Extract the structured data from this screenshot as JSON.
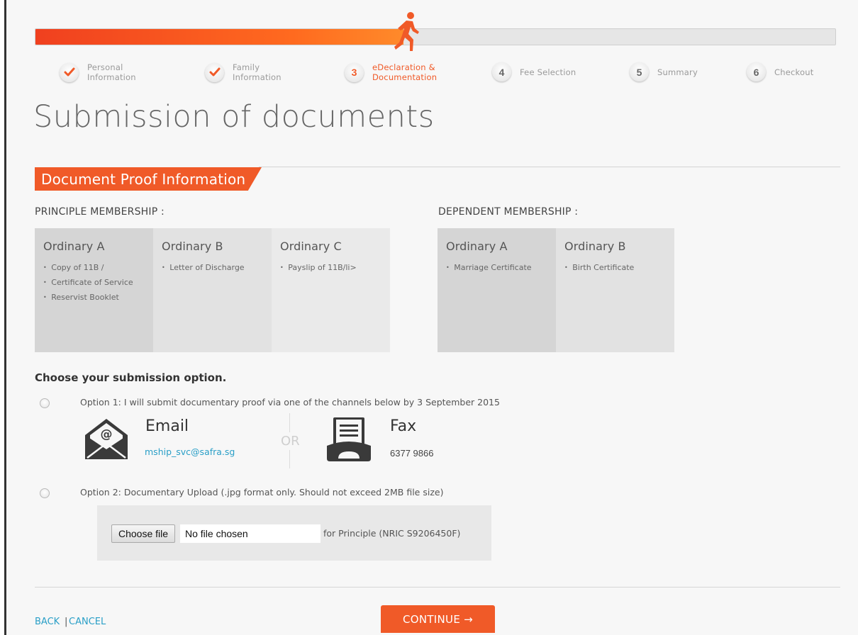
{
  "progress": {
    "fraction": 0.46,
    "accent": "#f05a28",
    "steps": [
      {
        "number": "",
        "label": "Personal Information",
        "status": "done"
      },
      {
        "number": "",
        "label": "Family Information",
        "status": "done"
      },
      {
        "number": "3",
        "label": "eDeclaration & Documentation",
        "status": "active"
      },
      {
        "number": "4",
        "label": "Fee Selection",
        "status": "todo"
      },
      {
        "number": "5",
        "label": "Summary",
        "status": "todo"
      },
      {
        "number": "6",
        "label": "Checkout",
        "status": "todo"
      }
    ]
  },
  "page_title": "Submission of documents",
  "section_title": "Document Proof Information",
  "principle": {
    "heading": "PRINCIPLE MEMBERSHIP :",
    "cards": [
      {
        "title": "Ordinary A",
        "items": [
          "Copy of 11B /",
          "Certificate of Service",
          "Reservist Booklet"
        ]
      },
      {
        "title": "Ordinary B",
        "items": [
          "Letter of Discharge"
        ]
      },
      {
        "title": "Ordinary C",
        "items": [
          "Payslip of 11B/li>"
        ]
      }
    ]
  },
  "dependent": {
    "heading": "DEPENDENT MEMBERSHIP :",
    "cards": [
      {
        "title": "Ordinary A",
        "items": [
          "Marriage Certificate"
        ]
      },
      {
        "title": "Ordinary B",
        "items": [
          "Birth Certificate"
        ]
      }
    ]
  },
  "submission": {
    "title": "Choose your submission option.",
    "option1": {
      "text": "Option 1: I will submit documentary proof via one of the channels below by 3 September 2015",
      "email_title": "Email",
      "email_address": "mship_svc@safra.sg",
      "or_text": "OR",
      "fax_title": "Fax",
      "fax_number": "6377 9866",
      "email_icon": "envelope-icon",
      "fax_icon": "fax-icon"
    },
    "option2": {
      "text": "Option 2: Documentary Upload (.jpg format only. Should not exceed 2MB file size)",
      "choose_file_label": "Choose file",
      "file_status": "No file chosen",
      "for_text": "for Principle (NRIC S9206450F)"
    }
  },
  "footer": {
    "back_label": "BACK",
    "separator": "|",
    "cancel_label": "CANCEL",
    "continue_label": "CONTINUE →"
  }
}
